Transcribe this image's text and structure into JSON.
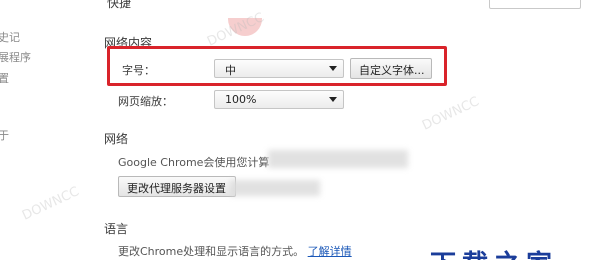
{
  "sidebar": {
    "fragments": [
      "史记",
      "展程序",
      "置",
      "于"
    ]
  },
  "header": {
    "truncated_title": "快捷"
  },
  "sections": {
    "web_content": {
      "title": "网络内容",
      "font_size_label": "字号：",
      "font_size_value": "中",
      "customize_fonts_button": "自定义字体...",
      "page_zoom_label": "网页缩放：",
      "page_zoom_value": "100%"
    },
    "network": {
      "title": "网络",
      "description": "Google Chrome会使用您计算",
      "proxy_button": "更改代理服务器设置"
    },
    "language": {
      "title": "语言",
      "description": "更改Chrome处理和显示语言的方式。",
      "learn_more_link": "了解详情"
    }
  },
  "colors": {
    "highlight_border": "#d9232a",
    "link": "#1b58b8",
    "brand_watermark": "#1b3d9a"
  }
}
